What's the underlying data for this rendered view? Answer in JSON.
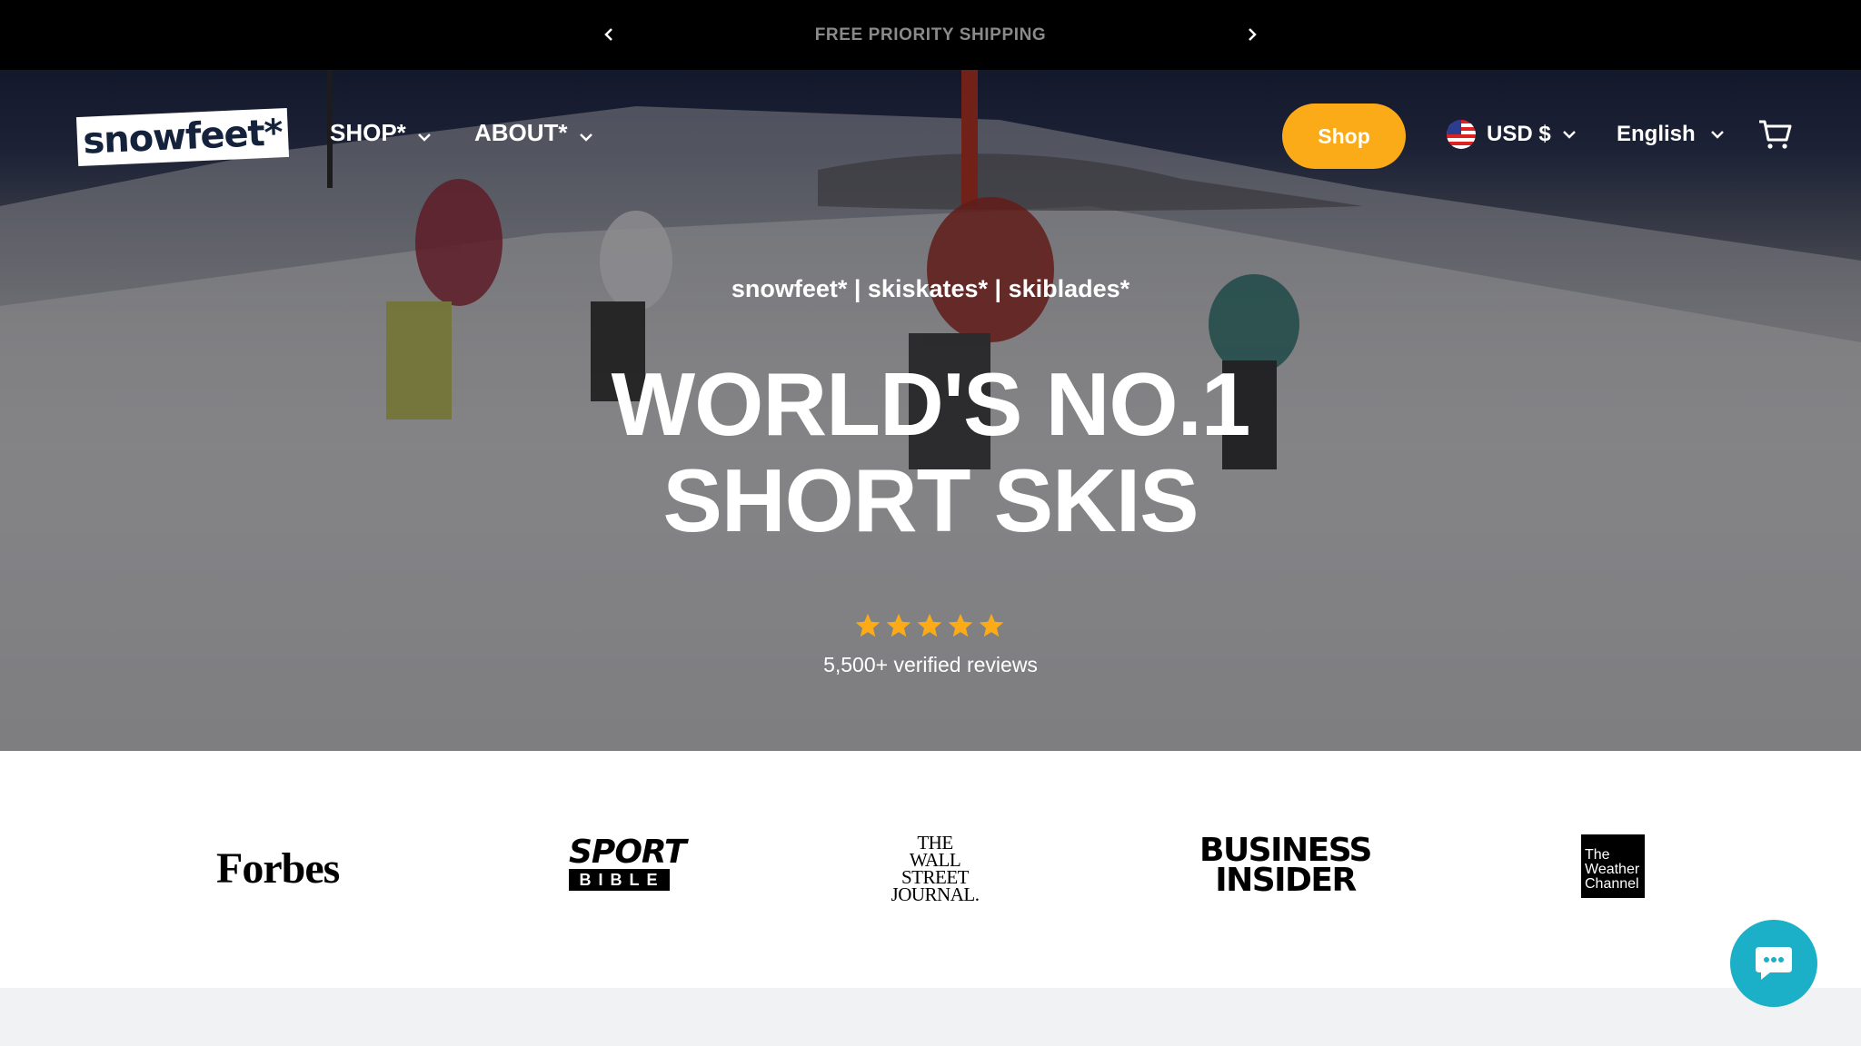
{
  "announcement": {
    "message": "FREE PRIORITY SHIPPING",
    "prev_icon": "chevron-left-icon",
    "next_icon": "chevron-right-icon"
  },
  "header": {
    "logo_text": "snowfeet*",
    "nav": [
      {
        "label": "SHOP*",
        "icon": "chevron-down-icon"
      },
      {
        "label": "ABOUT*",
        "icon": "chevron-down-icon"
      }
    ],
    "shop_button": "Shop",
    "currency": {
      "label": "USD $",
      "flag": "us-flag-icon"
    },
    "language": "English",
    "cart_icon": "cart-icon"
  },
  "hero": {
    "subtitle": "snowfeet* | skiskates* | skiblades*",
    "headline_line1": "WORLD'S NO.1",
    "headline_line2": "SHORT SKIS",
    "rating_stars": 5,
    "reviews": "5,500+ verified reviews"
  },
  "press": {
    "forbes": "Forbes",
    "sportbible_top": "SPORT",
    "sportbible_bottom": "BIBLE",
    "wsj_line1": "THE",
    "wsj_line2": "WALL STREET",
    "wsj_line3": "JOURNAL.",
    "bi_line1": "BUSINESS",
    "bi_line2": "INSIDER",
    "weather_line1": "The",
    "weather_line2": "Weather",
    "weather_line3": "Channel"
  },
  "colors": {
    "accent": "#fbab18",
    "chat": "#1bb0c8",
    "announcement_bg": "#000000",
    "logo_text": "#15223b"
  }
}
